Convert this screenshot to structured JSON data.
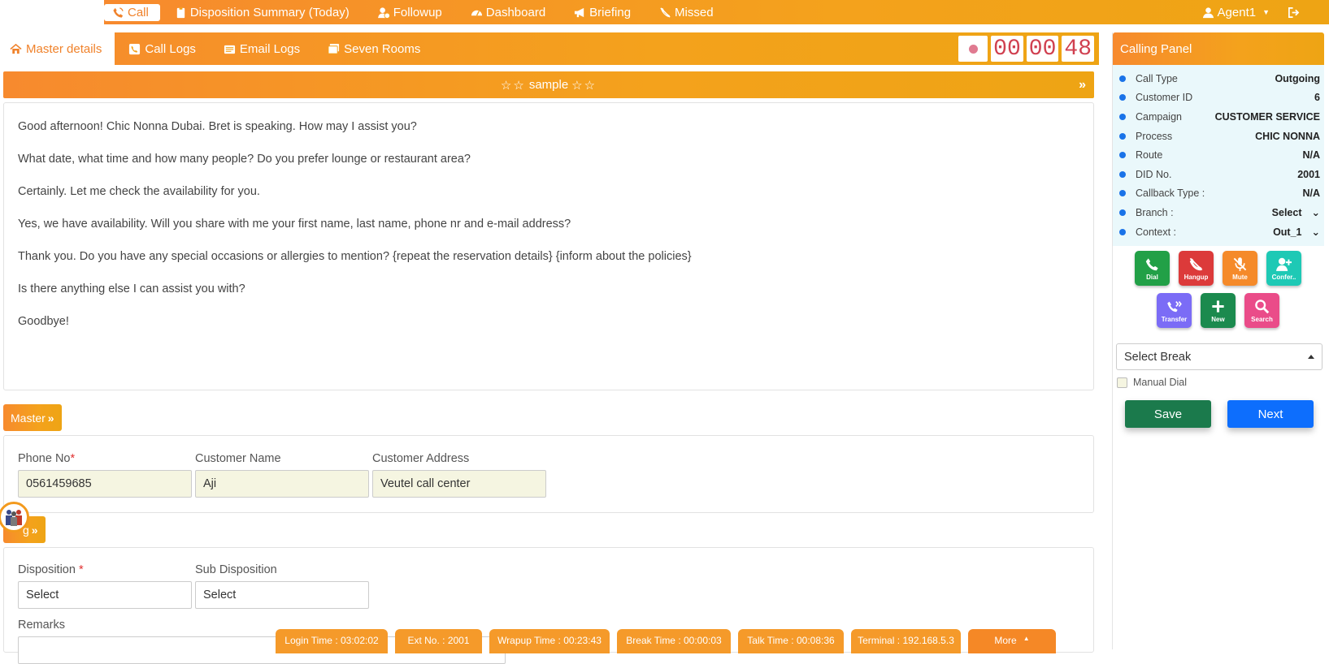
{
  "nav": {
    "items": [
      {
        "label": "Call",
        "icon": "phone-ring-icon"
      },
      {
        "label": "Disposition Summary (Today)",
        "icon": "clipboard-icon"
      },
      {
        "label": "Followup",
        "icon": "user-clock-icon"
      },
      {
        "label": "Dashboard",
        "icon": "gauge-icon"
      },
      {
        "label": "Briefing",
        "icon": "megaphone-icon"
      },
      {
        "label": "Missed",
        "icon": "phone-slash-icon"
      }
    ],
    "user": "Agent1"
  },
  "tabs": [
    {
      "label": "Master details",
      "icon": "home-icon"
    },
    {
      "label": "Call Logs",
      "icon": "phone-square-icon"
    },
    {
      "label": "Email Logs",
      "icon": "envelope-icon"
    },
    {
      "label": "Seven Rooms",
      "icon": "window-icon"
    }
  ],
  "timer": {
    "hours": "00",
    "minutes": "00",
    "seconds": "48"
  },
  "sample_title": "sample",
  "script_lines": [
    "Good afternoon! Chic Nonna Dubai. Bret is speaking. How may I assist you?",
    "What date, what time and how many people?  Do you prefer lounge or restaurant area?",
    "Certainly. Let me check the availability for you.",
    "Yes, we have availability. Will you share with me your first name, last name, phone nr and e-mail address?",
    "Thank you. Do you have any special occasions or allergies to mention?  {repeat the reservation details}  {inform about the policies}",
    "Is there anything else I can assist you with?",
    "Goodbye!"
  ],
  "master": {
    "button_label": "Master",
    "phone_label": "Phone No",
    "phone_value": "0561459685",
    "name_label": "Customer Name",
    "name_value": "Aji",
    "address_label": "Customer Address",
    "address_value": "Veutel call center"
  },
  "disposition": {
    "button_label": "g",
    "disposition_label": "Disposition",
    "disposition_value": "Select",
    "sub_label": "Sub Disposition",
    "sub_value": "Select",
    "remarks_label": "Remarks"
  },
  "calling_panel": {
    "title": "Calling Panel",
    "rows": [
      {
        "key": "Call Type",
        "value": "Outgoing"
      },
      {
        "key": "Customer ID",
        "value": "6"
      },
      {
        "key": "Campaign",
        "value": "CUSTOMER SERVICE"
      },
      {
        "key": "Process",
        "value": "CHIC NONNA"
      },
      {
        "key": "Route",
        "value": "N/A"
      },
      {
        "key": "DID No.",
        "value": "2001"
      },
      {
        "key": "Callback Type :",
        "value": "N/A"
      },
      {
        "key": "Branch :",
        "value": "Select"
      },
      {
        "key": "Context :",
        "value": "Out_1"
      }
    ],
    "actions": [
      "Dial",
      "Hangup",
      "Mute",
      "Confer..",
      "Transfer",
      "New",
      "Search"
    ],
    "action_colors": [
      "#22a047",
      "#dc3a3a",
      "#f58a2a",
      "#1ec9b5",
      "#7b6cf6",
      "#1b8a4e",
      "#ea4c89"
    ],
    "break_placeholder": "Select Break",
    "manual_dial": "Manual Dial",
    "save": "Save",
    "next": "Next"
  },
  "status": [
    "Login Time : 03:02:02",
    "Ext No. : 2001",
    "Wrapup Time : 00:23:43",
    "Break Time : 00:00:03",
    "Talk Time : 00:08:36",
    "Terminal : 192.168.5.3",
    "More"
  ]
}
